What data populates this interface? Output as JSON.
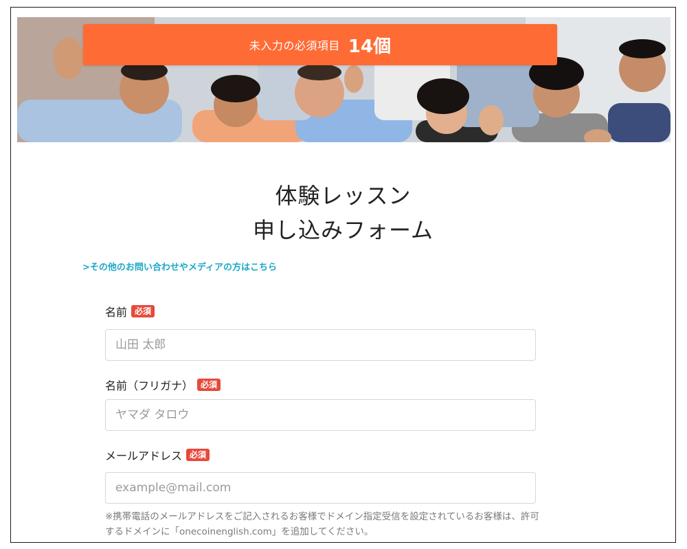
{
  "banner": {
    "counter_label": "未入力の必須項目",
    "counter_value": "14個",
    "accent_color": "#ff6b35"
  },
  "title": {
    "line1": "体験レッスン",
    "line2": "申し込みフォーム"
  },
  "other_inquiry_link": ">その他のお問い合わせやメディアの方はこちら",
  "form": {
    "required_badge": "必須",
    "fields": [
      {
        "label": "名前",
        "placeholder": "山田 太郎",
        "value": ""
      },
      {
        "label": "名前（フリガナ）",
        "placeholder": "ヤマダ タロウ",
        "value": ""
      },
      {
        "label": "メールアドレス",
        "placeholder": "example@mail.com",
        "value": ""
      }
    ],
    "email_note": "※携帯電話のメールアドレスをご記入されるお客様でドメイン指定受信を設定されているお客様は、許可するドメインに「onecoinenglish.com」を追加してください。"
  }
}
